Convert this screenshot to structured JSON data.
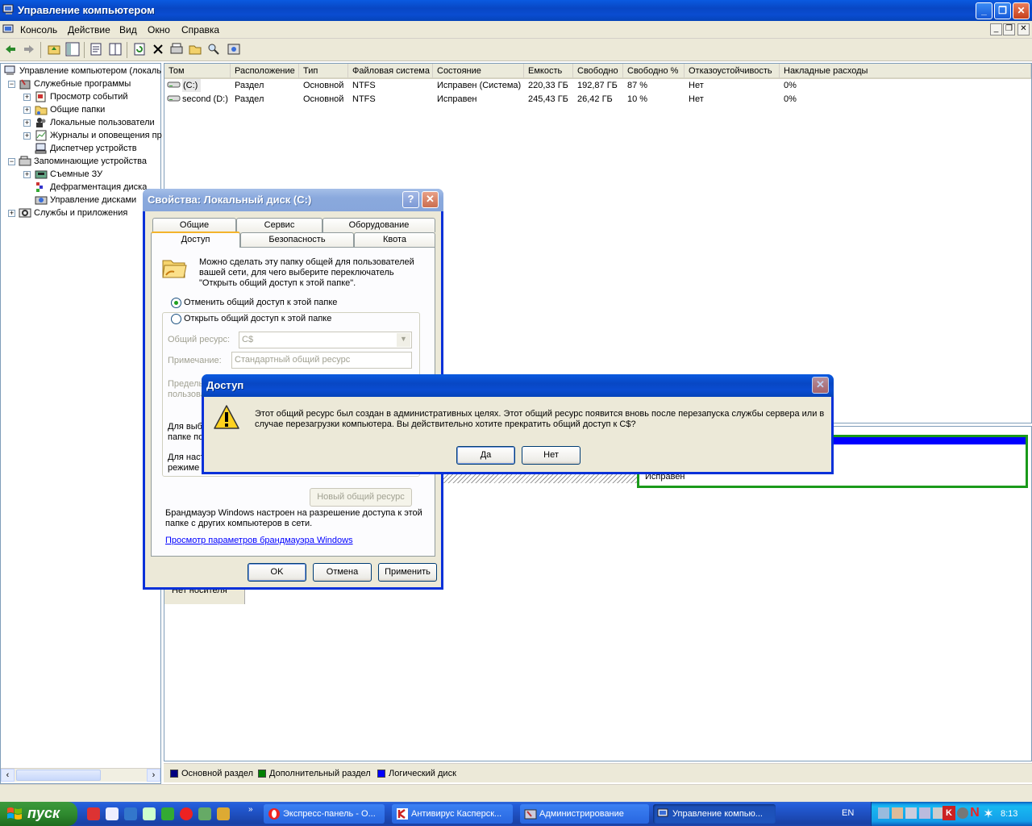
{
  "window": {
    "title": "Управление компьютером"
  },
  "menu": [
    "Консоль",
    "Действие",
    "Вид",
    "Окно",
    "Справка"
  ],
  "tree": {
    "root": "Управление компьютером (локаль",
    "items": [
      "Служебные программы",
      "Просмотр событий",
      "Общие папки",
      "Локальные пользователи",
      "Журналы и оповещения пр",
      "Диспетчер устройств",
      "Запоминающие устройства",
      "Съемные ЗУ",
      "Дефрагментация диска",
      "Управление дисками",
      "Службы и приложения"
    ]
  },
  "volumes": {
    "headers": [
      "Том",
      "Расположение",
      "Тип",
      "Файловая система",
      "Состояние",
      "Емкость",
      "Свободно",
      "Свободно %",
      "Отказоустойчивость",
      "Накладные расходы"
    ],
    "rows": [
      [
        "(C:)",
        "Раздел",
        "Основной",
        "NTFS",
        "Исправен (Система)",
        "220,33 ГБ",
        "192,87 ГБ",
        "87 %",
        "Нет",
        "0%"
      ],
      [
        "second (D:)",
        "Раздел",
        "Основной",
        "NTFS",
        "Исправен",
        "245,43 ГБ",
        "26,42 ГБ",
        "10 %",
        "Нет",
        "0%"
      ]
    ]
  },
  "lower": {
    "status_partial": "Исправен",
    "no_media": "Нет носителя"
  },
  "legend": [
    "Основной раздел",
    "Дополнительный раздел",
    "Логический диск"
  ],
  "legend_colors": [
    "#000080",
    "#008000",
    "#0000ff"
  ],
  "props_dialog": {
    "title": "Свойства: Локальный диск (C:)",
    "tabs_row1": [
      "Общие",
      "Сервис",
      "Оборудование"
    ],
    "tabs_row2": [
      "Доступ",
      "Безопасность",
      "Квота"
    ],
    "description": "Можно сделать эту папку общей для пользователей вашей сети, для чего выберите переключатель \"Открыть общий доступ к этой папке\".",
    "radio_off": "Отменить общий доступ к этой папке",
    "radio_on": "Открыть общий доступ к этой папке",
    "share_label": "Общий ресурс:",
    "share_value": "C$",
    "comment_label": "Примечание:",
    "comment_value": "Стандартный общий ресурс",
    "limit_label_a": "Предель",
    "limit_label_b": "пользова",
    "perm_text_a": "Для выб",
    "perm_text_b": "папке по",
    "cache_text_a": "Для наст",
    "cache_text_b": "режиме",
    "new_share": "Новый общий ресурс",
    "firewall_text": "Брандмауэр Windows настроен на разрешение доступа к этой папке с других компьютеров в сети.",
    "firewall_link": "Просмотр параметров брандмауэра Windows",
    "ok": "OK",
    "cancel": "Отмена",
    "apply": "Применить"
  },
  "confirm_dialog": {
    "title": "Доступ",
    "message": "Этот общий ресурс был создан в административных целях. Этот общий ресурс появится вновь после перезапуска службы сервера или в случае перезагрузки компьютера. Вы действительно хотите прекратить общий доступ к C$?",
    "yes": "Да",
    "no": "Нет"
  },
  "taskbar": {
    "start": "пуск",
    "tasks": [
      "Экспресс-панель - О...",
      "Антивирус Касперск...",
      "Администрирование",
      "Управление компью..."
    ],
    "lang": "EN",
    "clock": "8:13"
  }
}
